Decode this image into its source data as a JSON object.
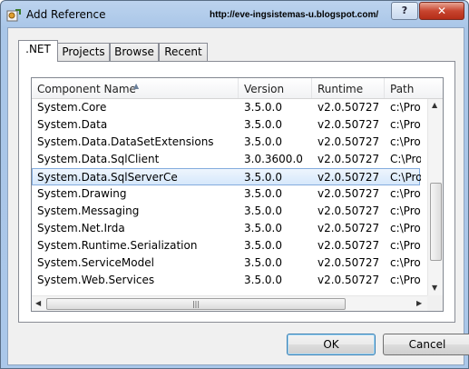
{
  "window": {
    "title": "Add Reference",
    "watermark": "http://eve-ingsistemas-u.blogspot.com/",
    "help_label": "?",
    "close_label": "✕"
  },
  "tabs": [
    {
      "label": ".NET",
      "active": true
    },
    {
      "label": "Projects",
      "active": false
    },
    {
      "label": "Browse",
      "active": false
    },
    {
      "label": "Recent",
      "active": false
    }
  ],
  "columns": [
    "Component Name",
    "Version",
    "Runtime",
    "Path"
  ],
  "rows": [
    {
      "name": "System.Core",
      "version": "3.5.0.0",
      "runtime": "v2.0.50727",
      "path": "c:\\Pro"
    },
    {
      "name": "System.Data",
      "version": "3.5.0.0",
      "runtime": "v2.0.50727",
      "path": "c:\\Pro"
    },
    {
      "name": "System.Data.DataSetExtensions",
      "version": "3.5.0.0",
      "runtime": "v2.0.50727",
      "path": "c:\\Pro"
    },
    {
      "name": "System.Data.SqlClient",
      "version": "3.0.3600.0",
      "runtime": "v2.0.50727",
      "path": "C:\\Pro"
    },
    {
      "name": "System.Data.SqlServerCe",
      "version": "3.5.0.0",
      "runtime": "v2.0.50727",
      "path": "C:\\Pro",
      "selected": true
    },
    {
      "name": "System.Drawing",
      "version": "3.5.0.0",
      "runtime": "v2.0.50727",
      "path": "c:\\Pro"
    },
    {
      "name": "System.Messaging",
      "version": "3.5.0.0",
      "runtime": "v2.0.50727",
      "path": "c:\\Pro"
    },
    {
      "name": "System.Net.Irda",
      "version": "3.5.0.0",
      "runtime": "v2.0.50727",
      "path": "c:\\Pro"
    },
    {
      "name": "System.Runtime.Serialization",
      "version": "3.5.0.0",
      "runtime": "v2.0.50727",
      "path": "c:\\Pro"
    },
    {
      "name": "System.ServiceModel",
      "version": "3.5.0.0",
      "runtime": "v2.0.50727",
      "path": "c:\\Pro"
    },
    {
      "name": "System.Web.Services",
      "version": "3.5.0.0",
      "runtime": "v2.0.50727",
      "path": "c:\\Pro"
    }
  ],
  "buttons": {
    "ok": "OK",
    "cancel": "Cancel"
  },
  "icons": {
    "sort": "sort-up-icon",
    "app": "add-reference-icon"
  },
  "colors": {
    "selection_border": "#84acdd",
    "title_bar": "#aac7e9",
    "close_button": "#c8452f"
  }
}
